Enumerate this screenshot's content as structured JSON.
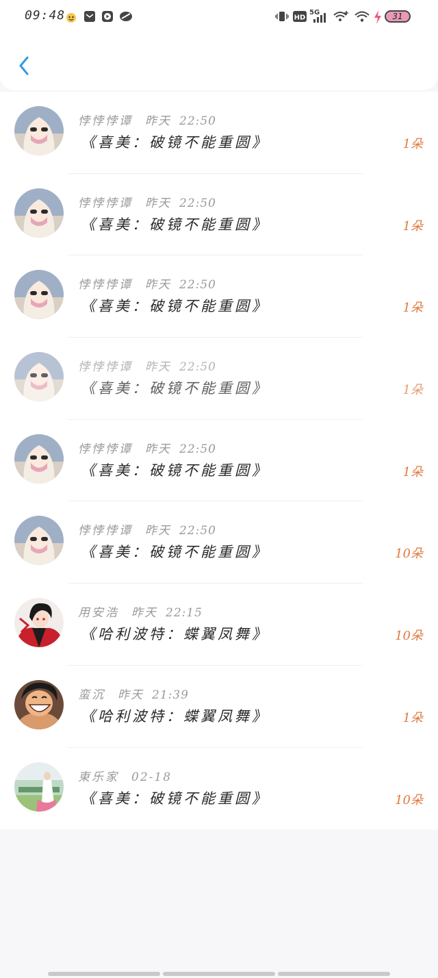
{
  "status_bar": {
    "time": "09:48",
    "network": "5G",
    "hd": "HD",
    "battery": "31"
  },
  "records": [
    {
      "name": "悖悖悖谭",
      "date": "昨天",
      "time": "22:50",
      "title": "《喜美：破镜不能重圆》",
      "count": "1朵",
      "avatar": "anime-girl-white-hair"
    },
    {
      "name": "悖悖悖谭",
      "date": "昨天",
      "time": "22:50",
      "title": "《喜美：破镜不能重圆》",
      "count": "1朵",
      "avatar": "anime-girl-white-hair"
    },
    {
      "name": "悖悖悖谭",
      "date": "昨天",
      "time": "22:50",
      "title": "《喜美：破镜不能重圆》",
      "count": "1朵",
      "avatar": "anime-girl-white-hair"
    },
    {
      "name": "悖悖悖谭",
      "date": "昨天",
      "time": "22:50",
      "title": "《喜美：破镜不能重圆》",
      "count": "1朵",
      "avatar": "anime-girl-white-hair"
    },
    {
      "name": "悖悖悖谭",
      "date": "昨天",
      "time": "22:50",
      "title": "《喜美：破镜不能重圆》",
      "count": "1朵",
      "avatar": "anime-girl-white-hair"
    },
    {
      "name": "悖悖悖谭",
      "date": "昨天",
      "time": "22:50",
      "title": "《喜美：破镜不能重圆》",
      "count": "10朵",
      "avatar": "anime-girl-white-hair"
    },
    {
      "name": "用安浩",
      "date": "昨天",
      "time": "22:15",
      "title": "《哈利波特：蝶翼凤舞》",
      "count": "10朵",
      "avatar": "anime-boy-red"
    },
    {
      "name": "蛮沉",
      "date": "昨天",
      "time": "21:39",
      "title": "《哈利波特：蝶翼凤舞》",
      "count": "1朵",
      "avatar": "anime-luffy-smile"
    },
    {
      "name": "東乐家",
      "date": "02-18",
      "time": "",
      "title": "《喜美：破镜不能重圆》",
      "count": "10朵",
      "avatar": "photo-girl-field"
    }
  ]
}
